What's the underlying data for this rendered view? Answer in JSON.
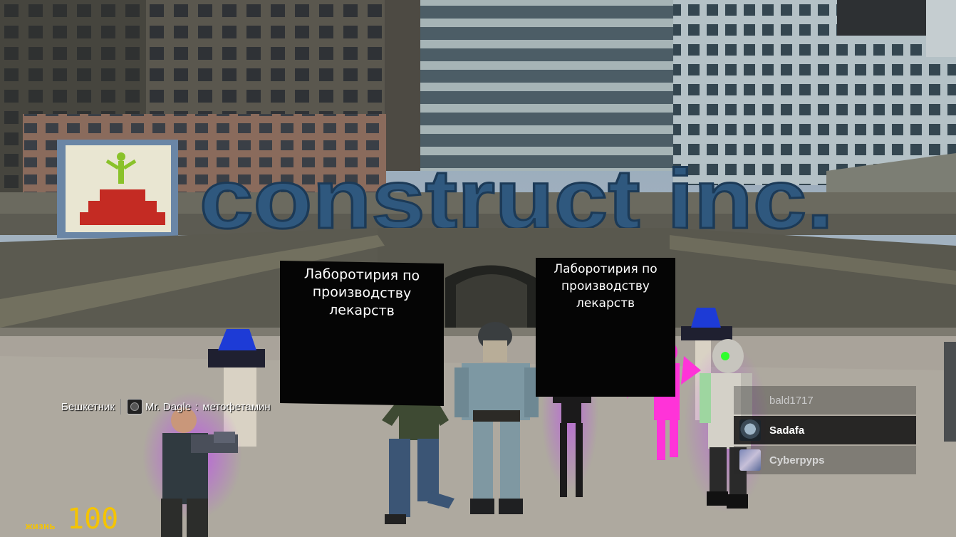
{
  "sign_left": {
    "lines": [
      "Лаборотирия по",
      "производству",
      "лекарств"
    ]
  },
  "sign_right": {
    "lines": [
      "Лаборотирия по",
      "производству",
      "лекарств"
    ]
  },
  "billboard": {
    "logo_text": "construct inc."
  },
  "killfeed": {
    "victim": "Бешкетник",
    "player": "Mr. Dagle",
    "message": "метофетамин"
  },
  "player_list": [
    {
      "name": "bald1717",
      "state": "dim"
    },
    {
      "name": "Sadafa",
      "state": "active"
    },
    {
      "name": "Cyberpyps",
      "state": "normal"
    }
  ],
  "hud": {
    "health_label": "жизнь",
    "health_value": "100"
  }
}
